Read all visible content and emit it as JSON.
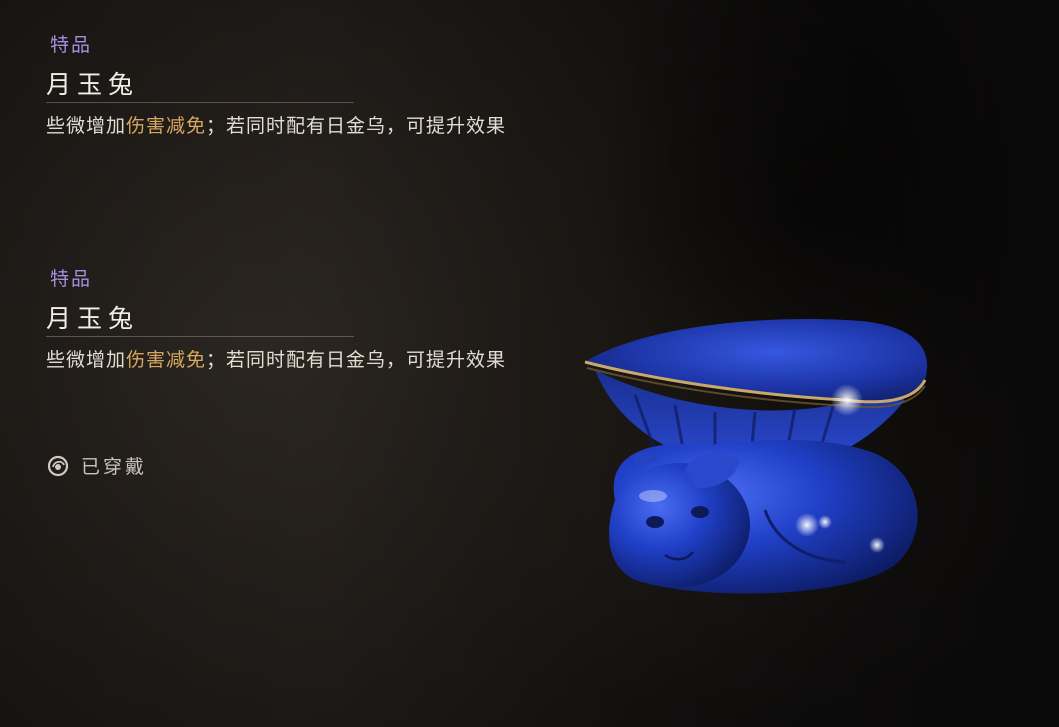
{
  "items": [
    {
      "rarity": "特品",
      "name": "月玉兔",
      "desc_pre": "些微增加",
      "desc_highlight": "伤害减免",
      "desc_post": "；若同时配有日金乌，可提升效果"
    },
    {
      "rarity": "特品",
      "name": "月玉兔",
      "desc_pre": "些微增加",
      "desc_highlight": "伤害减免",
      "desc_post": "；若同时配有日金乌，可提升效果"
    }
  ],
  "equipped": {
    "label": "已穿戴",
    "icon": "equipped-ring-icon"
  },
  "artifact": {
    "icon": "blue-jade-rabbit-pillow",
    "color": "#1f3fc8"
  },
  "colors": {
    "rarity": "#a58fe0",
    "highlight": "#d8a860",
    "text": "#e2ddd2"
  }
}
